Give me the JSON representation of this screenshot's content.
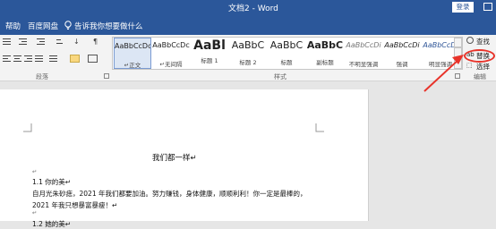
{
  "titlebar": {
    "doc_title": "文档2 - Word",
    "login_label": "登录"
  },
  "tabs": [
    "帮助",
    "百度网盘"
  ],
  "tell_me": {
    "text": "告诉我你想要做什么"
  },
  "ribbon": {
    "groups": {
      "paragraph": "段落",
      "styles": "样式",
      "editing": "编辑"
    },
    "styles": [
      {
        "preview": "AaBbCcDc",
        "name": "↵正文"
      },
      {
        "preview": "AaBbCcDc",
        "name": "↵无间隔"
      },
      {
        "preview": "AaBl",
        "name": "标题 1"
      },
      {
        "preview": "AaBbC",
        "name": "标题 2"
      },
      {
        "preview": "AaBbC",
        "name": "标题"
      },
      {
        "preview": "AaBbC",
        "name": "副标题"
      },
      {
        "preview": "AaBbCcDi",
        "name": "不明显强调"
      },
      {
        "preview": "AaBbCcDi",
        "name": "强调"
      },
      {
        "preview": "AaBbCcDi",
        "name": "明显强调"
      }
    ],
    "editing": {
      "find": "查找",
      "replace": "替换",
      "select": "选择"
    }
  },
  "document": {
    "heading": "我们都一样↵",
    "lines": [
      "↵",
      "1.1 你的美↵",
      "自月光朱砂痣，2021 年我们都要加油。努力赚钱，身体健康，顺顺利利！你一定是最棒的，",
      "2021 年我只想暴富暴瘦！↵",
      "↵",
      "1.2 她的美↵"
    ]
  },
  "colors": {
    "brand": "#2b579a",
    "annotation": "#e8332a"
  }
}
